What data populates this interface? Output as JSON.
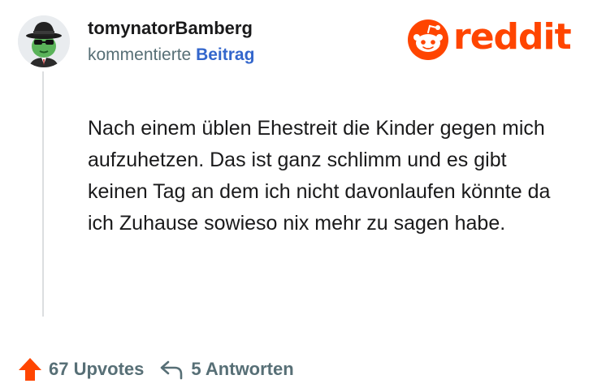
{
  "comment": {
    "author": "tomynatorBamberg",
    "action_text": "kommentierte",
    "post_link_text": "Beitrag",
    "body": "Nach einem üblen Ehestreit die Kinder gegen mich aufzuhetzen. Das ist ganz schlimm und es gibt keinen Tag an dem ich nicht davonlaufen könnte da ich Zuhause sowieso nix mehr zu sagen habe.",
    "upvotes_label": "67 Upvotes",
    "replies_label": "5 Antworten"
  },
  "branding": {
    "logo_text": "reddit",
    "logo_icon": "reddit-snoo-icon"
  },
  "icons": {
    "upvote": "upvote-arrow-icon",
    "reply": "reply-arrow-icon"
  },
  "colors": {
    "brand": "#ff4500",
    "post_link": "#3366cc",
    "meta": "#576f76",
    "text": "#1a1a1b"
  }
}
